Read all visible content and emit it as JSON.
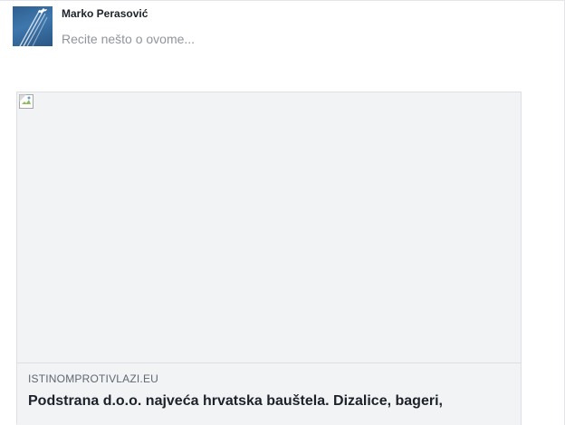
{
  "post_composer": {
    "user_name": "Marko Perasović",
    "placeholder": "Recite nešto o ovome..."
  },
  "link_preview": {
    "domain": "ISTINOMPROTIVLAZI.EU",
    "title": "Podstrana d.o.o. najveća hrvatska bauštela. Dizalice, bageri,"
  },
  "colors": {
    "name_text": "#1d2129",
    "placeholder_text": "#90949c",
    "card_background": "#f2f3f5",
    "card_border": "#dddfe2",
    "domain_text": "#606770"
  }
}
